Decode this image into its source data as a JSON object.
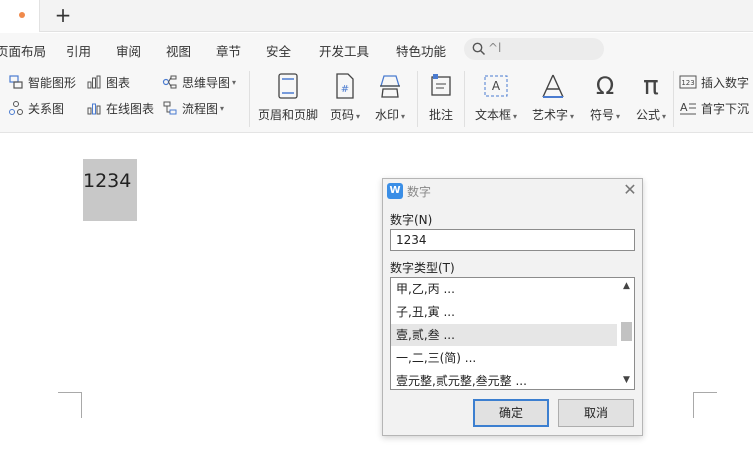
{
  "tabbar": {
    "new_tab_label": "+"
  },
  "menu": {
    "items": [
      "页面布局",
      "引用",
      "审阅",
      "视图",
      "章节",
      "安全",
      "开发工具",
      "特色功能"
    ],
    "search_placeholder": "^l"
  },
  "ribbon": {
    "smart_art": "智能图形",
    "chart": "图表",
    "mind_map": "思维导图",
    "relation_map": "关系图",
    "online_chart": "在线图表",
    "flowchart": "流程图",
    "header_footer": "页眉和页脚",
    "page_number": "页码",
    "watermark": "水印",
    "comment": "批注",
    "text_box": "文本框",
    "word_art": "艺术字",
    "symbol": "符号",
    "formula": "公式",
    "insert_number": "插入数字",
    "drop_cap": "首字下沉"
  },
  "document": {
    "field_text": "1234"
  },
  "dialog": {
    "title": "数字",
    "number_label": "数字(N)",
    "number_value": "1234",
    "type_label": "数字类型(T)",
    "types": [
      "甲,乙,丙 ...",
      "子,丑,寅 ...",
      "壹,贰,叁 ...",
      "一,二,三(简) ...",
      "壹元整,贰元整,叁元整 ..."
    ],
    "selected_type": "壹,贰,叁 ...",
    "ok_label": "确定",
    "cancel_label": "取消"
  },
  "colors": {
    "accent": "#3c7fd0",
    "tab_dot": "#f08a4b",
    "field_bg": "#c8c8c8"
  }
}
